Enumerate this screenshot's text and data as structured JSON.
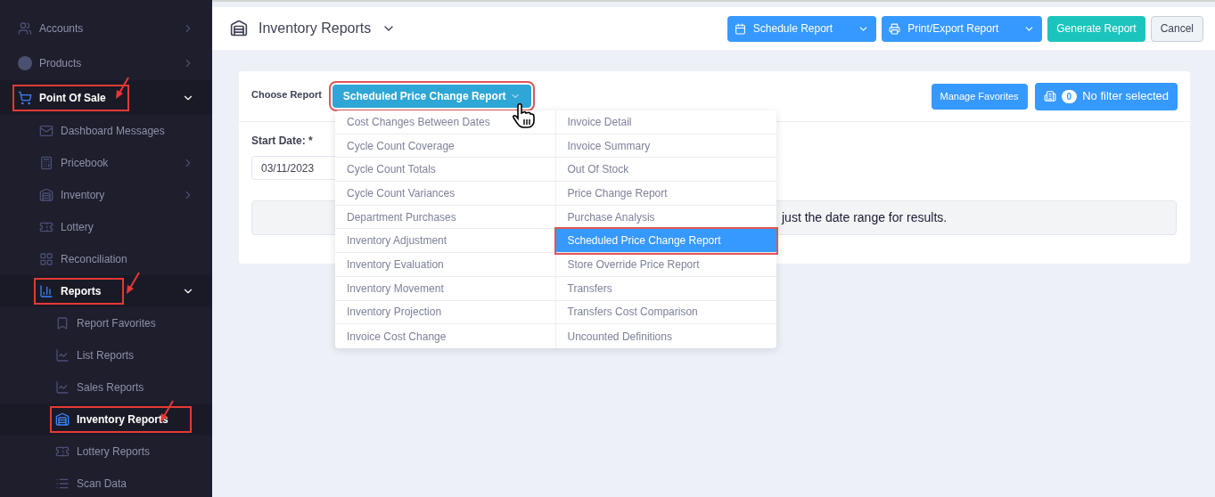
{
  "sidebar": {
    "items": [
      {
        "label": "Accounts",
        "expanded": false,
        "has_children": true,
        "selected": false,
        "annotated": false
      },
      {
        "label": "Products",
        "expanded": false,
        "has_children": true,
        "selected": false,
        "annotated": false
      },
      {
        "label": "Point Of Sale",
        "expanded": true,
        "has_children": true,
        "selected": true,
        "annotated": true,
        "children": [
          {
            "label": "Dashboard Messages",
            "has_children": false,
            "selected": false,
            "annotated": false
          },
          {
            "label": "Pricebook",
            "has_children": true,
            "expanded": false,
            "selected": false,
            "annotated": false
          },
          {
            "label": "Inventory",
            "has_children": true,
            "expanded": false,
            "selected": false,
            "annotated": false
          },
          {
            "label": "Lottery",
            "has_children": false,
            "selected": false,
            "annotated": false
          },
          {
            "label": "Reconciliation",
            "has_children": false,
            "selected": false,
            "annotated": false
          },
          {
            "label": "Reports",
            "has_children": true,
            "expanded": true,
            "selected": true,
            "annotated": true,
            "children": [
              {
                "label": "Report Favorites",
                "has_children": false,
                "selected": false,
                "annotated": false
              },
              {
                "label": "List Reports",
                "has_children": false,
                "selected": false,
                "annotated": false
              },
              {
                "label": "Sales Reports",
                "has_children": false,
                "selected": false,
                "annotated": false
              },
              {
                "label": "Inventory Reports",
                "has_children": false,
                "selected": true,
                "annotated": true
              },
              {
                "label": "Lottery Reports",
                "has_children": false,
                "selected": false,
                "annotated": false
              },
              {
                "label": "Scan Data",
                "has_children": false,
                "selected": false,
                "annotated": false
              }
            ]
          }
        ]
      }
    ]
  },
  "header": {
    "title": "Inventory Reports",
    "buttons": [
      {
        "label": "Schedule Report",
        "kind": "split"
      },
      {
        "label": "Print/Export Report",
        "kind": "split"
      },
      {
        "label": "Generate Report",
        "kind": "success"
      },
      {
        "label": "Cancel",
        "kind": "plain"
      }
    ]
  },
  "report": {
    "choose_label": "Choose Report",
    "selected_report": "Scheduled Price Change Report",
    "annotated": true,
    "manage_favorites": "Manage Favorites",
    "filter_count": "0",
    "filter_label": "No filter selected",
    "start_date_label": "Start Date: *",
    "start_date": "03/11/2023",
    "alert": "just the date range for results.",
    "menu_columns": [
      [
        {
          "label": "Cost Changes Between Dates",
          "selected": false
        },
        {
          "label": "Cycle Count Coverage",
          "selected": false
        },
        {
          "label": "Cycle Count Totals",
          "selected": false
        },
        {
          "label": "Cycle Count Variances",
          "selected": false
        },
        {
          "label": "Department Purchases",
          "selected": false
        },
        {
          "label": "Inventory Adjustment",
          "selected": false
        },
        {
          "label": "Inventory Evaluation",
          "selected": false
        },
        {
          "label": "Inventory Movement",
          "selected": false
        },
        {
          "label": "Inventory Projection",
          "selected": false
        },
        {
          "label": "Invoice Cost Change",
          "selected": false
        }
      ],
      [
        {
          "label": "Invoice Detail",
          "selected": false
        },
        {
          "label": "Invoice Summary",
          "selected": false
        },
        {
          "label": "Out Of Stock",
          "selected": false
        },
        {
          "label": "Price Change Report",
          "selected": false
        },
        {
          "label": "Purchase Analysis",
          "selected": false
        },
        {
          "label": "Scheduled Price Change Report",
          "selected": true
        },
        {
          "label": "Store Override Price Report",
          "selected": false
        },
        {
          "label": "Transfers",
          "selected": false
        },
        {
          "label": "Transfers Cost Comparison",
          "selected": false
        },
        {
          "label": "Uncounted Definitions",
          "selected": false
        }
      ]
    ]
  }
}
